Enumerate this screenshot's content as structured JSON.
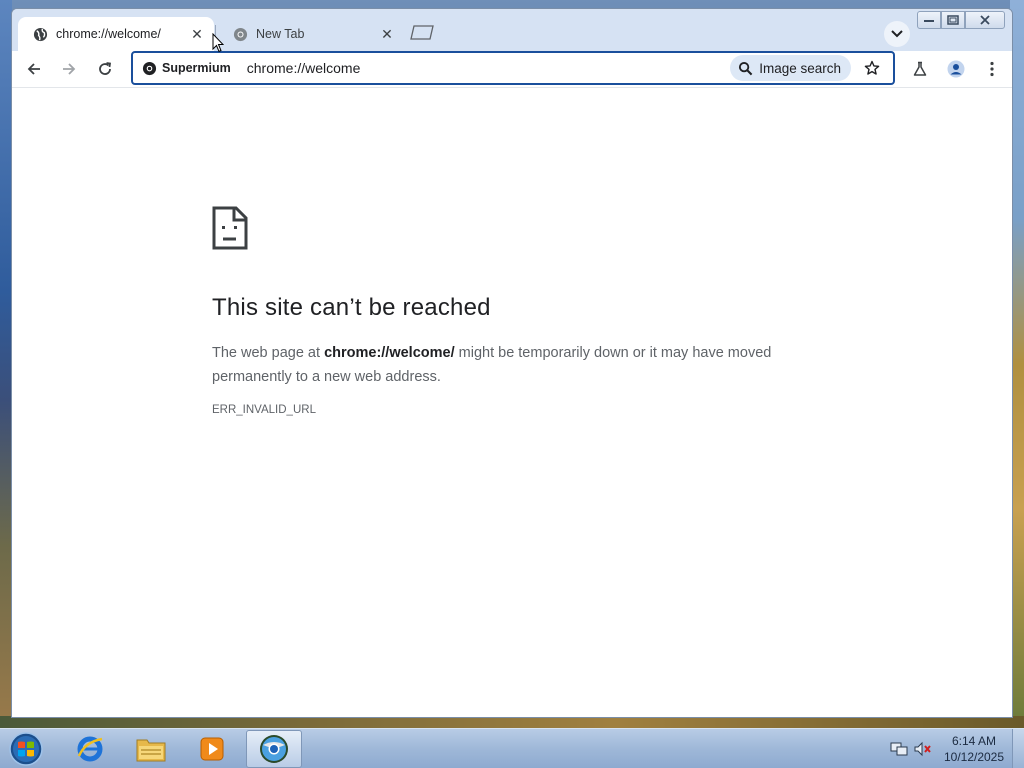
{
  "browser": {
    "tabs": [
      {
        "title": "chrome://welcome/",
        "active": true
      },
      {
        "title": "New Tab",
        "active": false
      }
    ],
    "toolbar": {
      "chip_label": "Supermium",
      "url": "chrome://welcome",
      "image_search_label": "Image search"
    },
    "error_page": {
      "title": "This site can’t be reached",
      "body_prefix": "The web page at ",
      "body_url": "chrome://welcome/",
      "body_suffix": " might be temporarily down or it may have moved permanently to a new web address.",
      "error_code": "ERR_INVALID_URL"
    }
  },
  "taskbar": {
    "clock_time": "6:14 AM",
    "clock_date": "10/12/2025",
    "apps": [
      "internet-explorer",
      "windows-explorer",
      "media-player",
      "supermium"
    ]
  },
  "colors": {
    "accent": "#1a4f9c",
    "titlebar": "#d6e2f3",
    "chip_bg": "#dde8f6"
  }
}
